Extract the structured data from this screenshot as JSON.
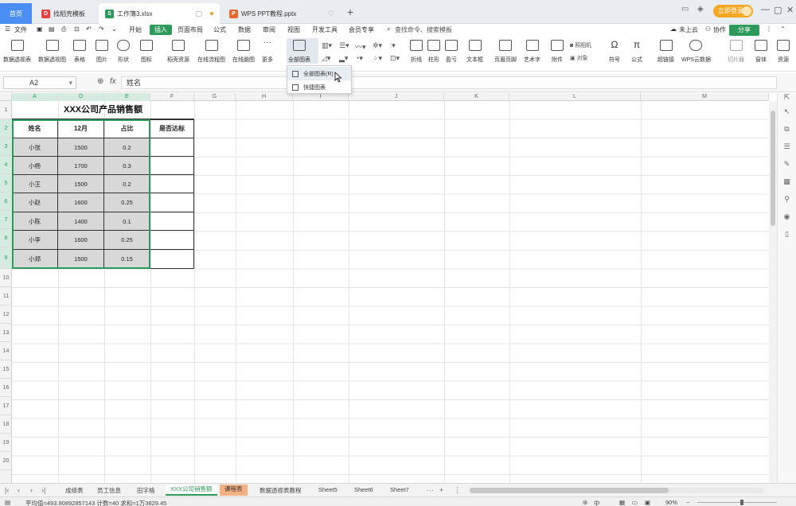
{
  "tabs": {
    "home": "首页",
    "t1": "找稻壳模板",
    "t2": "工作簿3.xlsx",
    "t3": "WPS PPT教程.pptx"
  },
  "titlebar": {
    "login": "立即登录"
  },
  "menu": {
    "file": "文件",
    "items": [
      "开始",
      "插入",
      "页面布局",
      "公式",
      "数据",
      "审阅",
      "视图",
      "开发工具",
      "会员专享"
    ],
    "search": "查找命令、搜索模板",
    "cloud": "未上云",
    "collab": "协作",
    "share": "分享"
  },
  "ribbon": {
    "buttons": [
      "数据透视表",
      "数据透视图",
      "表格",
      "图片",
      "形状",
      "图标",
      "稻壳资源",
      "在线流程图",
      "在线脑图",
      "更多",
      "全部图表",
      "折线",
      "柱形",
      "盈亏",
      "文本框",
      "页眉页脚",
      "艺术字",
      "附件",
      "对象",
      "符号",
      "公式",
      "超链接",
      "WPS云数据",
      "切片器",
      "窗体",
      "资源"
    ],
    "small": [
      "照相机"
    ]
  },
  "dropdown": {
    "item1": "全部图表(R)",
    "item2": "快捷图表"
  },
  "formula": {
    "cell": "A2",
    "content": "姓名"
  },
  "columns": [
    "A",
    "D",
    "E",
    "F",
    "G",
    "H",
    "I",
    "J",
    "K",
    "L",
    "M"
  ],
  "rows": [
    "1",
    "2",
    "3",
    "4",
    "5",
    "6",
    "7",
    "8",
    "9",
    "10",
    "11",
    "12",
    "13",
    "14",
    "15",
    "16",
    "17",
    "18",
    "19",
    "20"
  ],
  "table": {
    "title": "XXX公司产品销售额",
    "headers": [
      "姓名",
      "12月",
      "占比",
      "是否达标"
    ],
    "rows": [
      [
        "小张",
        "1500",
        "0.2",
        ""
      ],
      [
        "小杨",
        "1700",
        "0.3",
        ""
      ],
      [
        "小王",
        "1500",
        "0.2",
        ""
      ],
      [
        "小赵",
        "1600",
        "0.25",
        ""
      ],
      [
        "小陈",
        "1400",
        "0.1",
        ""
      ],
      [
        "小李",
        "1600",
        "0.25",
        ""
      ],
      [
        "小郑",
        "1500",
        "0.15",
        ""
      ]
    ]
  },
  "sheets": [
    "成绩表",
    "员工信息",
    "田字格",
    "XXX公司销售额",
    "课程表",
    "数据透视表教程",
    "Sheet5",
    "Sheet6",
    "Sheet7"
  ],
  "status": {
    "stats": "平均值=493.90892857143  计数=40  求和=1万3829.45",
    "zoom": "90%",
    "lang": "中"
  },
  "colors": {
    "accent": "#2c9a5b",
    "orange": "#f5a623",
    "blue": "#4a8ef4"
  }
}
